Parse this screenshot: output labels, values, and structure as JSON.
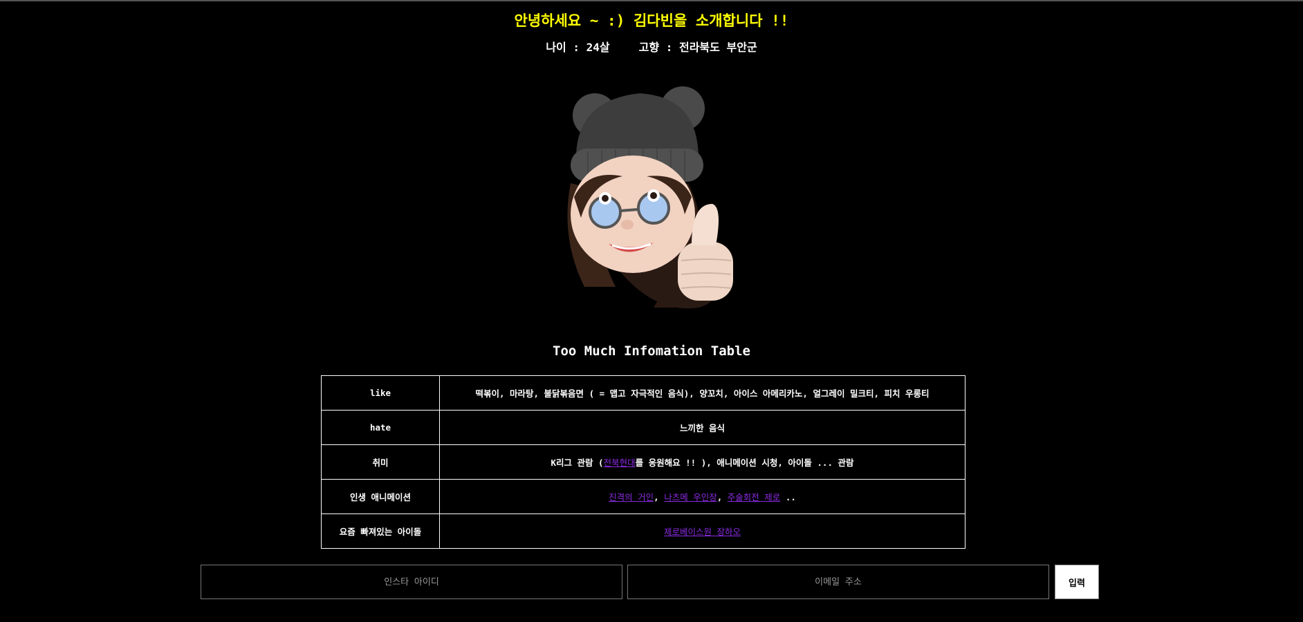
{
  "header": {
    "title": "안녕하세요 ~ :) 김다빈을 소개합니다 !!",
    "age": "나이 : 24살",
    "hometown": "고향 : 전라북도 부안군"
  },
  "avatar": {
    "icon": "memoji-avatar-thumbs-up"
  },
  "table": {
    "title": "Too Much Infomation Table",
    "rows": [
      {
        "key": "like",
        "value": "떡볶이, 마라탕, 불닭볶음면 ( = 맵고 자극적인 음식), 양꼬치, 아이스 아메리카노, 얼그레이 밀크티, 피치 우롱티"
      },
      {
        "key": "hate",
        "value": "느끼한 음식"
      },
      {
        "key": "취미",
        "value_before": "K리그 관람 (",
        "link": "전북현대",
        "value_after": "를 응원해요 !! ), 애니메이션 시청, 아이돌 ... 관람"
      },
      {
        "key": "인생 애니메이션",
        "links": [
          "진격의 거인",
          "나츠메 우인장",
          "주술회전 제로"
        ],
        "sep": ", ",
        "tail": " .."
      },
      {
        "key": "요즘 빠져있는 아이돌",
        "link": "제로베이스원 장하오"
      }
    ]
  },
  "form": {
    "insta_placeholder": "인스타 아이디",
    "email_placeholder": "이메일 주소",
    "submit_label": "입력"
  },
  "colors": {
    "title": "#ffff00",
    "link": "#8a2be2",
    "background": "#000000"
  }
}
